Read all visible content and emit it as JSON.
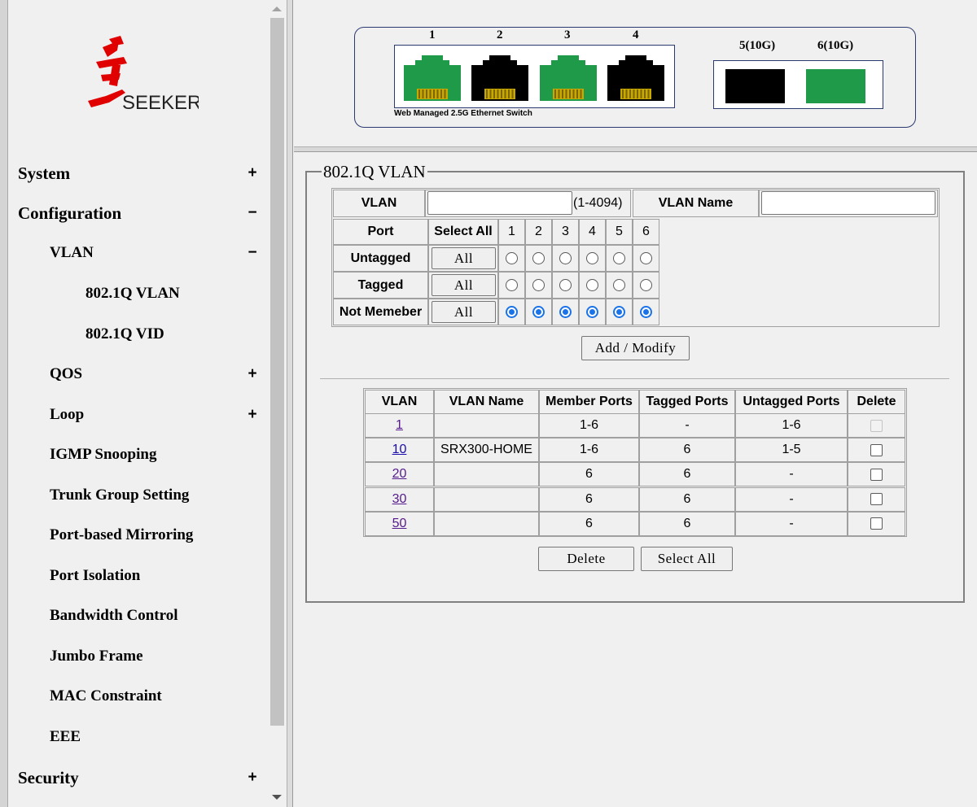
{
  "brand": {
    "logo_text": "SEEKER"
  },
  "sidebar": {
    "items": [
      {
        "label": "System",
        "sign": "+"
      },
      {
        "label": "Configuration",
        "sign": "−"
      },
      {
        "label": "VLAN",
        "sign": "−"
      },
      {
        "label": "802.1Q VLAN",
        "sign": ""
      },
      {
        "label": "802.1Q VID",
        "sign": ""
      },
      {
        "label": "QOS",
        "sign": "+"
      },
      {
        "label": "Loop",
        "sign": "+"
      },
      {
        "label": "IGMP Snooping",
        "sign": ""
      },
      {
        "label": "Trunk Group Setting",
        "sign": ""
      },
      {
        "label": "Port-based Mirroring",
        "sign": ""
      },
      {
        "label": "Port Isolation",
        "sign": ""
      },
      {
        "label": "Bandwidth Control",
        "sign": ""
      },
      {
        "label": "Jumbo Frame",
        "sign": ""
      },
      {
        "label": "MAC Constraint",
        "sign": ""
      },
      {
        "label": "EEE",
        "sign": ""
      },
      {
        "label": "Security",
        "sign": "+"
      }
    ]
  },
  "switch_panel": {
    "ports": [
      {
        "label": "1",
        "status": "up",
        "color": "#1e9a48"
      },
      {
        "label": "2",
        "status": "down",
        "color": "#000000"
      },
      {
        "label": "3",
        "status": "up",
        "color": "#1e9a48"
      },
      {
        "label": "4",
        "status": "down",
        "color": "#000000"
      }
    ],
    "sfp_ports": [
      {
        "label": "5(10G)",
        "status": "down",
        "color": "#000000"
      },
      {
        "label": "6(10G)",
        "status": "up",
        "color": "#1e9a48"
      }
    ],
    "caption": "Web Managed 2.5G Ethernet Switch"
  },
  "vlan_form": {
    "legend": "802.1Q VLAN",
    "vlan_label": "VLAN",
    "vlan_value": "",
    "vlan_range": "(1-4094)",
    "vlan_name_label": "VLAN Name",
    "vlan_name_value": "",
    "port_label": "Port",
    "select_all_label": "Select All",
    "port_numbers": [
      "1",
      "2",
      "3",
      "4",
      "5",
      "6"
    ],
    "rows": [
      {
        "label": "Untagged",
        "all_button": "All",
        "selected": [
          false,
          false,
          false,
          false,
          false,
          false
        ]
      },
      {
        "label": "Tagged",
        "all_button": "All",
        "selected": [
          false,
          false,
          false,
          false,
          false,
          false
        ]
      },
      {
        "label": "Not Memeber",
        "all_button": "All",
        "selected": [
          true,
          true,
          true,
          true,
          true,
          true
        ]
      }
    ],
    "add_modify_button": "Add / Modify"
  },
  "vlan_table": {
    "headers": [
      "VLAN",
      "VLAN Name",
      "Member Ports",
      "Tagged Ports",
      "Untagged Ports",
      "Delete"
    ],
    "rows": [
      {
        "vlan": "1",
        "name": "",
        "member": "1-6",
        "tagged": "-",
        "untagged": "1-6",
        "delete_disabled": true
      },
      {
        "vlan": "10",
        "name": "SRX300-HOME",
        "member": "1-6",
        "tagged": "6",
        "untagged": "1-5",
        "delete_disabled": false
      },
      {
        "vlan": "20",
        "name": "",
        "member": "6",
        "tagged": "6",
        "untagged": "-",
        "delete_disabled": false
      },
      {
        "vlan": "30",
        "name": "",
        "member": "6",
        "tagged": "6",
        "untagged": "-",
        "delete_disabled": false
      },
      {
        "vlan": "50",
        "name": "",
        "member": "6",
        "tagged": "6",
        "untagged": "-",
        "delete_disabled": false
      }
    ],
    "delete_button": "Delete",
    "select_all_button": "Select All"
  }
}
